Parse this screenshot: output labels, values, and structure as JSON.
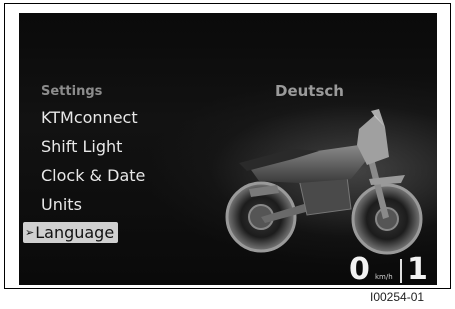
{
  "menu": {
    "heading": "Settings",
    "items": [
      {
        "label": "KTMconnect"
      },
      {
        "label": "Shift Light"
      },
      {
        "label": "Clock & Date"
      },
      {
        "label": "Units"
      },
      {
        "label": "Language",
        "selected": true
      }
    ]
  },
  "selected_value": "Deutsch",
  "status": {
    "speed": "0",
    "speed_unit": "km/h",
    "gear": "1"
  },
  "figure_id": "I00254-01",
  "icons": {
    "selection": "arrow-right-circle-icon",
    "motorcycle": "motorcycle-image"
  },
  "colors": {
    "screen_bg": "#0a0a0a",
    "highlight_bg": "#d0d0d0"
  }
}
